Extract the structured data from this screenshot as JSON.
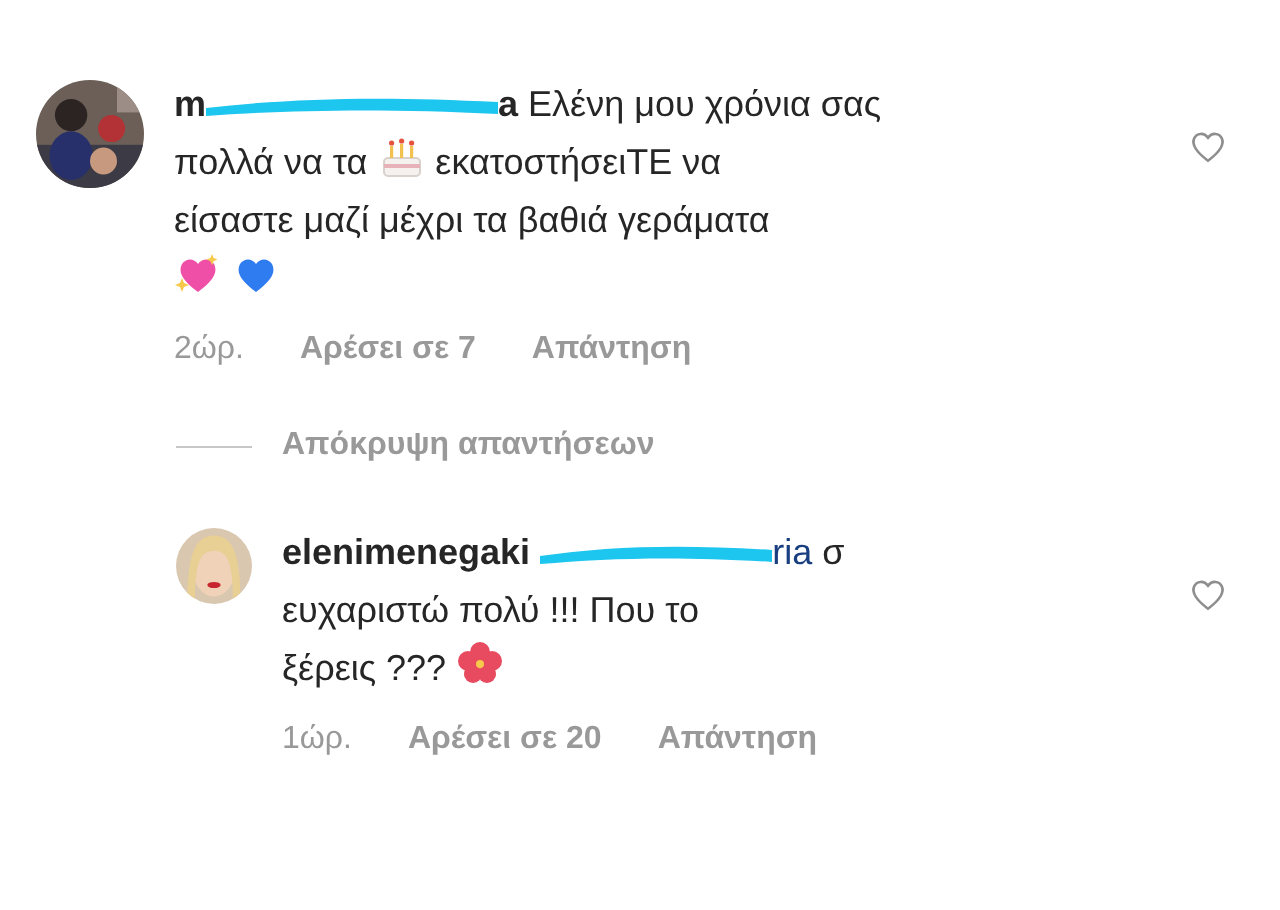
{
  "comments": [
    {
      "username_start": "m",
      "username_end": "a",
      "liked": false,
      "body": [
        {
          "kind": "text",
          "text": "Ελένη μου χρόνια σας"
        },
        {
          "kind": "break"
        },
        {
          "kind": "text",
          "text": "πολλά να τα"
        },
        {
          "kind": "cake"
        },
        {
          "kind": "text",
          "text": "εκατοστήσειΤΕ να"
        },
        {
          "kind": "break"
        },
        {
          "kind": "text",
          "text": "είσαστε μαζί μέχρι τα βαθιά γεράματα"
        },
        {
          "kind": "break"
        },
        {
          "kind": "sparkle-heart"
        },
        {
          "kind": "blue-heart"
        }
      ],
      "time": "2ώρ.",
      "likes": "Αρέσει σε 7",
      "reply": "Απάντηση",
      "hide_replies": "Απόκρυψη απαντήσεων",
      "replies": [
        {
          "username": "elenimenegaki",
          "mention_end": "ria",
          "liked": false,
          "body": [
            {
              "kind": "text",
              "text": "σ"
            },
            {
              "kind": "break"
            },
            {
              "kind": "text",
              "text": "ευχαριστώ πολύ !!! Που το"
            },
            {
              "kind": "break"
            },
            {
              "kind": "text",
              "text": "ξέρεις ???"
            },
            {
              "kind": "hibiscus"
            }
          ],
          "time": "1ώρ.",
          "likes": "Αρέσει σε 20",
          "reply": "Απάντηση"
        }
      ]
    }
  ]
}
